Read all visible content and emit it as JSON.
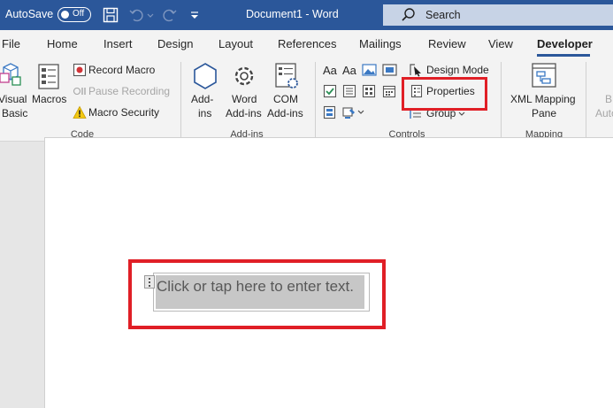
{
  "titlebar": {
    "autosave_label": "AutoSave",
    "autosave_state": "Off",
    "document_title": "Document1  -  Word",
    "search_placeholder": "Search"
  },
  "tabs": [
    "File",
    "Home",
    "Insert",
    "Design",
    "Layout",
    "References",
    "Mailings",
    "Review",
    "View",
    "Developer"
  ],
  "active_tab": "Developer",
  "ribbon": {
    "code": {
      "visual_basic": [
        "Visual",
        "Basic"
      ],
      "macros": "Macros",
      "record_macro": "Record Macro",
      "pause_recording": "Pause Recording",
      "macro_security": "Macro Security",
      "group_label": "Code"
    },
    "addins": {
      "addins": [
        "Add-",
        "ins"
      ],
      "word_addins": [
        "Word",
        "Add-ins"
      ],
      "com_addins": [
        "COM",
        "Add-ins"
      ],
      "group_label": "Add-ins"
    },
    "controls": {
      "design_mode": "Design Mode",
      "properties": "Properties",
      "group": "Group",
      "group_label": "Controls"
    },
    "mapping": {
      "xml_mapping_pane": [
        "XML Mapping",
        "Pane"
      ],
      "group_label": "Mapping"
    },
    "protect_partial": [
      "B",
      "Auto"
    ]
  },
  "document": {
    "content_control_placeholder": "Click or tap here to enter text."
  },
  "colors": {
    "word_blue": "#2b579a",
    "highlight_red": "#e01f26"
  }
}
